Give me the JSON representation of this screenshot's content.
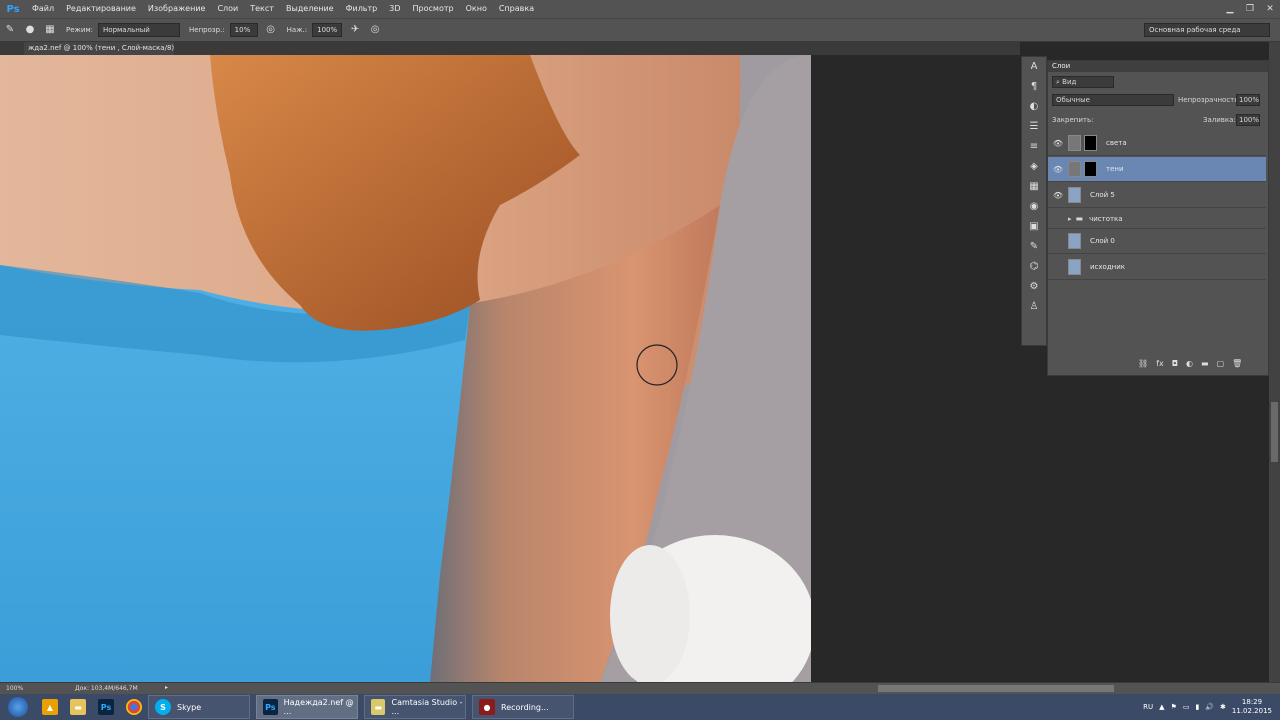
{
  "app": {
    "logo": "Ps"
  },
  "menu": [
    "Файл",
    "Редактирование",
    "Изображение",
    "Слои",
    "Текст",
    "Выделение",
    "Фильтр",
    "3D",
    "Просмотр",
    "Окно",
    "Справка"
  ],
  "options": {
    "mode_label": "Режим:",
    "mode_value": "Нормальный",
    "opacity_label": "Непрозр.:",
    "opacity_value": "10%",
    "flow_label": "Наж.:",
    "flow_value": "100%",
    "workspace": "Основная рабочая среда"
  },
  "document": {
    "tab_title": "жда2.nef @ 100% (тени , Слой-маска/8) *"
  },
  "status": {
    "zoom": "100%",
    "doc_size": "Док: 103,4M/646,7M"
  },
  "layers_panel": {
    "title": "Слои",
    "filter_label": "Вид",
    "blend_mode": "Обычные",
    "opacity_label": "Непрозрачность:",
    "opacity_value": "100%",
    "lock_label": "Закрепить:",
    "fill_label": "Заливка:",
    "fill_value": "100%",
    "layers": [
      {
        "name": "света",
        "visible": true,
        "selected": false
      },
      {
        "name": "тени",
        "visible": true,
        "selected": true
      },
      {
        "name": "Слой 5",
        "visible": true,
        "selected": false
      },
      {
        "name": "чистотка",
        "visible": false,
        "selected": false
      },
      {
        "name": "Слой 0",
        "visible": false,
        "selected": false
      },
      {
        "name": "исходник",
        "visible": false,
        "selected": false
      }
    ]
  },
  "taskbar": {
    "apps": [
      {
        "label": "Skype"
      },
      {
        "label": "Надежда2.nef @ ..."
      },
      {
        "label": "Camtasia Studio - ..."
      },
      {
        "label": "Recording..."
      }
    ],
    "lang": "RU",
    "time": "18:29",
    "date": "11.02.2015"
  }
}
